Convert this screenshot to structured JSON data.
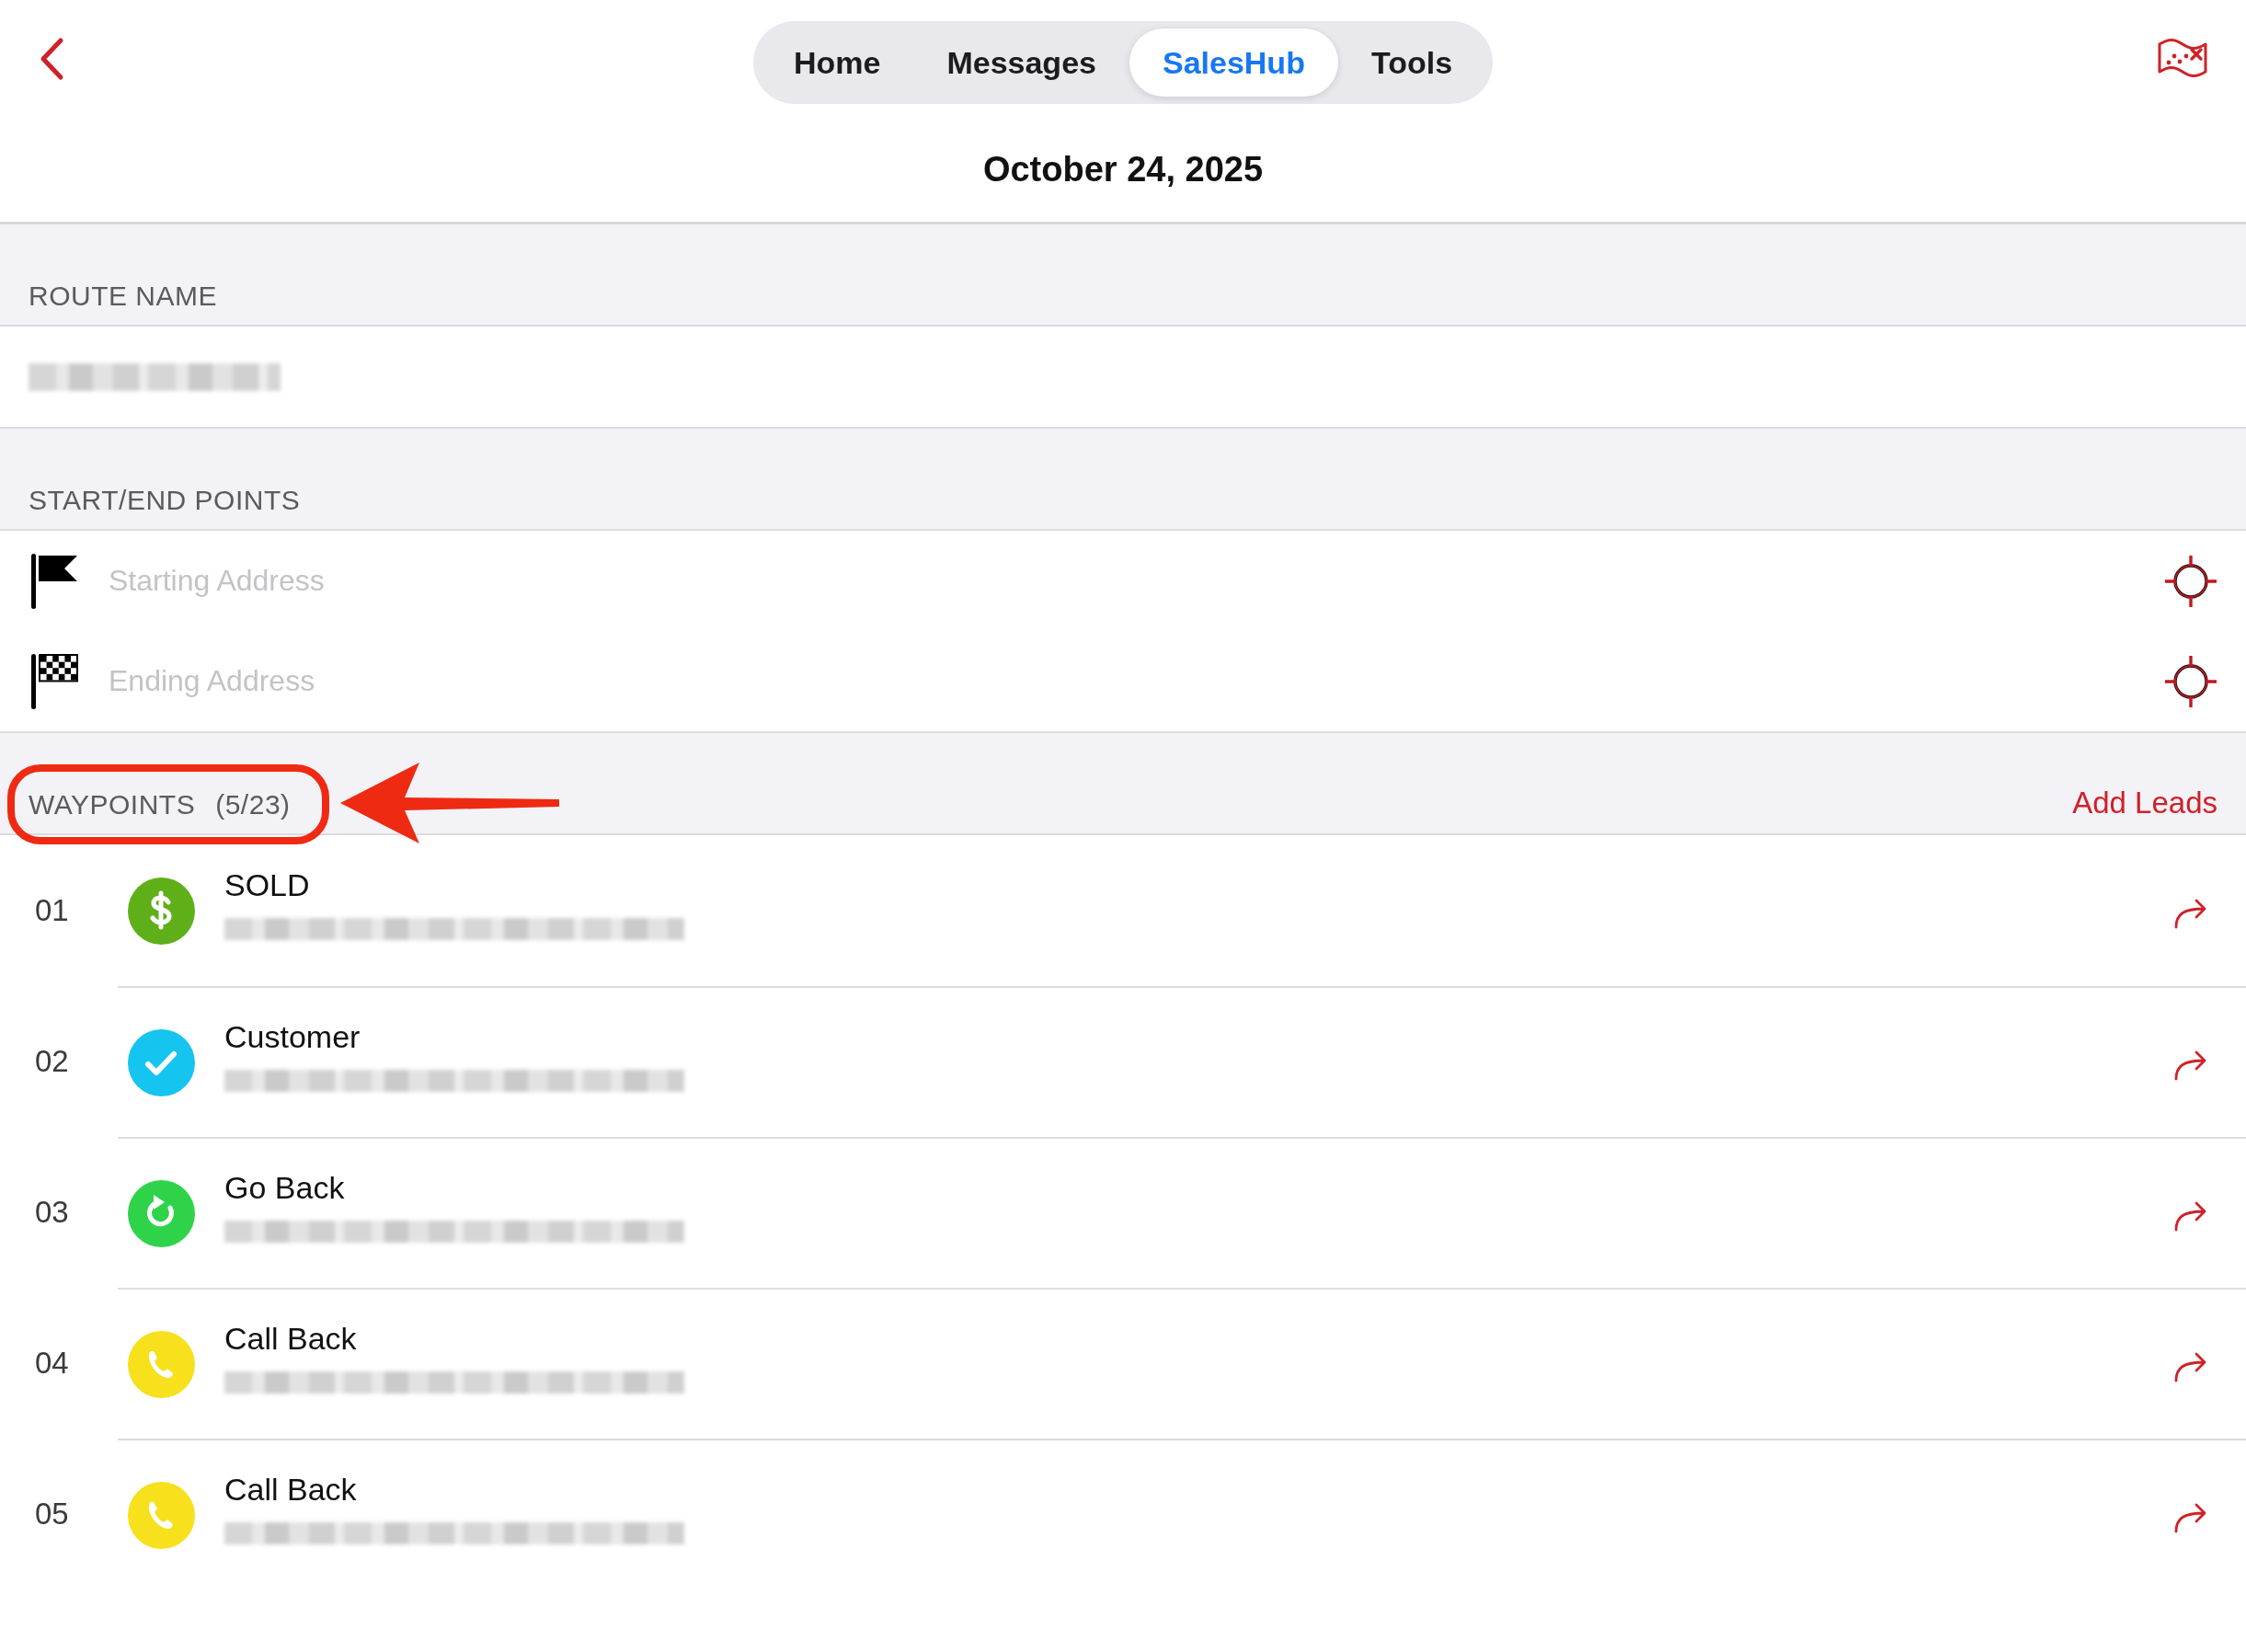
{
  "nav": {
    "back": true,
    "tabs": [
      {
        "label": "Home",
        "selected": false
      },
      {
        "label": "Messages",
        "selected": false
      },
      {
        "label": "SalesHub",
        "selected": true
      },
      {
        "label": "Tools",
        "selected": false
      }
    ]
  },
  "date": "October 24, 2025",
  "route_name": {
    "header": "ROUTE NAME",
    "value_redacted": true
  },
  "endpoints": {
    "header": "START/END POINTS",
    "fields": [
      {
        "kind": "start",
        "placeholder": "Starting Address"
      },
      {
        "kind": "end",
        "placeholder": "Ending Address"
      }
    ]
  },
  "waypoints": {
    "title": "WAYPOINTS",
    "count": "(5/23)",
    "highlighted": true,
    "action": "Add Leads",
    "items": [
      {
        "number": "01",
        "status": "SOLD",
        "kind": "sold",
        "color": "#5fb018",
        "address_redacted": true
      },
      {
        "number": "02",
        "status": "Customer",
        "kind": "customer",
        "color": "#16c4f0",
        "address_redacted": true
      },
      {
        "number": "03",
        "status": "Go Back",
        "kind": "go_back",
        "color": "#2fd34a",
        "address_redacted": true
      },
      {
        "number": "04",
        "status": "Call Back",
        "kind": "call_back",
        "color": "#f7e01c",
        "address_redacted": true
      },
      {
        "number": "05",
        "status": "Call Back",
        "kind": "call_back",
        "color": "#f7e01c",
        "address_redacted": true
      }
    ]
  }
}
